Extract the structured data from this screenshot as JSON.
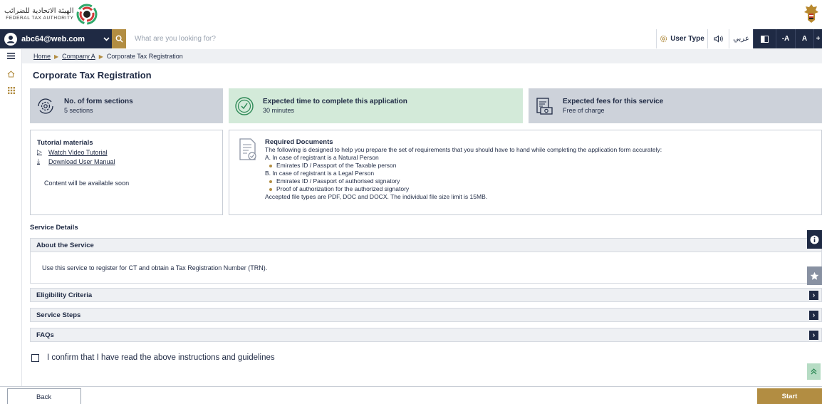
{
  "header": {
    "logo_arabic": "الهيئة الاتحادية للضرائب",
    "logo_english": "FEDERAL TAX AUTHORITY"
  },
  "navbar": {
    "user_email": "abc64@web.com",
    "search_placeholder": "What are you looking for?",
    "user_type_label": "User Type",
    "language_label": "عربي",
    "font_decrease_label": "-A",
    "font_reset_label": "A",
    "font_increase_label": "+"
  },
  "breadcrumb": {
    "home": "Home",
    "company": "Company A",
    "current": "Corporate Tax Registration"
  },
  "page": {
    "title": "Corporate Tax Registration"
  },
  "cards": [
    {
      "title": "No. of form sections",
      "value": "5 sections",
      "icon": "gear-cycle-icon"
    },
    {
      "title": "Expected time to complete this application",
      "value": "30 minutes",
      "icon": "clock-check-icon"
    },
    {
      "title": "Expected fees for this service",
      "value": "Free of charge",
      "icon": "invoice-money-icon"
    }
  ],
  "tutorial": {
    "title": "Tutorial materials",
    "video_link": "Watch Video Tutorial",
    "manual_link": "Download User Manual",
    "soon_text": "Content will be available soon"
  },
  "documents": {
    "title": "Required Documents",
    "intro": "The following is designed to help you prepare the set of requirements that you should have to hand while completing the application form accurately:",
    "section_a": "A. In case of registrant is a Natural Person",
    "section_a_items": [
      "Emirates ID / Passport of the Taxable person"
    ],
    "section_b": "B. In case of registrant is a Legal Person",
    "section_b_items": [
      "Emirates ID / Passport of authorised signatory",
      "Proof of authorization for the authorized signatory"
    ],
    "footer": "Accepted file types are PDF, DOC and DOCX. The individual file size limit is 15MB."
  },
  "service_details": {
    "heading": "Service Details",
    "about_title": "About the Service",
    "about_text": "Use this service to register for CT and obtain a Tax Registration Number (TRN).",
    "eligibility_title": "Eligibility Criteria",
    "steps_title": "Service Steps",
    "faqs_title": "FAQs"
  },
  "confirm": {
    "label": "I confirm that I have read the above instructions and guidelines"
  },
  "footer": {
    "back_label": "Back",
    "start_label": "Start"
  },
  "colors": {
    "navy": "#1f2a44",
    "gold": "#b28d42",
    "card_grey": "#cdd2da",
    "card_green": "#d3ead9"
  }
}
